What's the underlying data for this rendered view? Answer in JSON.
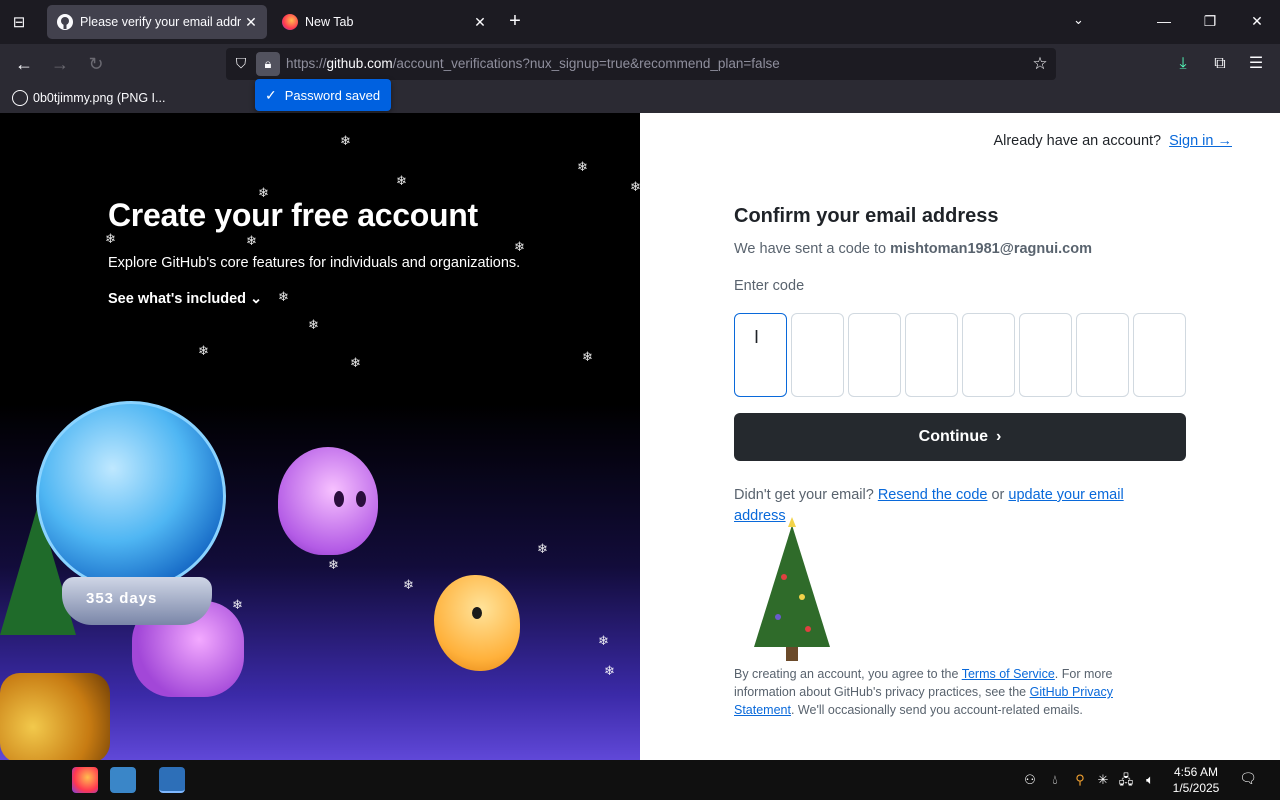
{
  "browser": {
    "tabs": [
      {
        "title": "Please verify your email address",
        "active": true,
        "favicon": "github-icon"
      },
      {
        "title": "New Tab",
        "active": false,
        "favicon": "firefox-icon"
      }
    ],
    "url": {
      "prefix": "https://",
      "host": "github.com",
      "path": "/account_verifications?nux_signup=true&recommend_plan=false"
    },
    "bookmark": "0b0tjimmy.png (PNG I...",
    "toast": "Password saved"
  },
  "page": {
    "left": {
      "title": "Create your free account",
      "subtitle": "Explore GitHub's core features for individuals and organizations.",
      "see_included": "See what's included",
      "globe_label": "353 days"
    },
    "right": {
      "already": "Already have an account?",
      "sign_in": "Sign in →",
      "confirm_title": "Confirm your email address",
      "sent_prefix": "We have sent a code to ",
      "email": "mishtoman1981@ragnui.com",
      "enter_code": "Enter code",
      "code_digits": [
        "",
        "",
        "",
        "",
        "",
        "",
        "",
        ""
      ],
      "continue": "Continue",
      "didnt_prefix": "Didn't get your email? ",
      "resend": "Resend the code",
      "or": " or ",
      "update": "update your email address",
      "terms_1": "By creating an account, you agree to the ",
      "terms_link": "Terms of Service",
      "terms_2": ". For more information about GitHub's privacy practices, see the ",
      "privacy_link": "GitHub Privacy Statement",
      "terms_3": ". We'll occasionally send you account-related emails."
    }
  },
  "taskbar": {
    "time": "4:56 AM",
    "date": "1/5/2025"
  },
  "colors": {
    "accent_link": "#0969da",
    "button_dark": "#25292e",
    "toast_blue": "#0061e0"
  }
}
